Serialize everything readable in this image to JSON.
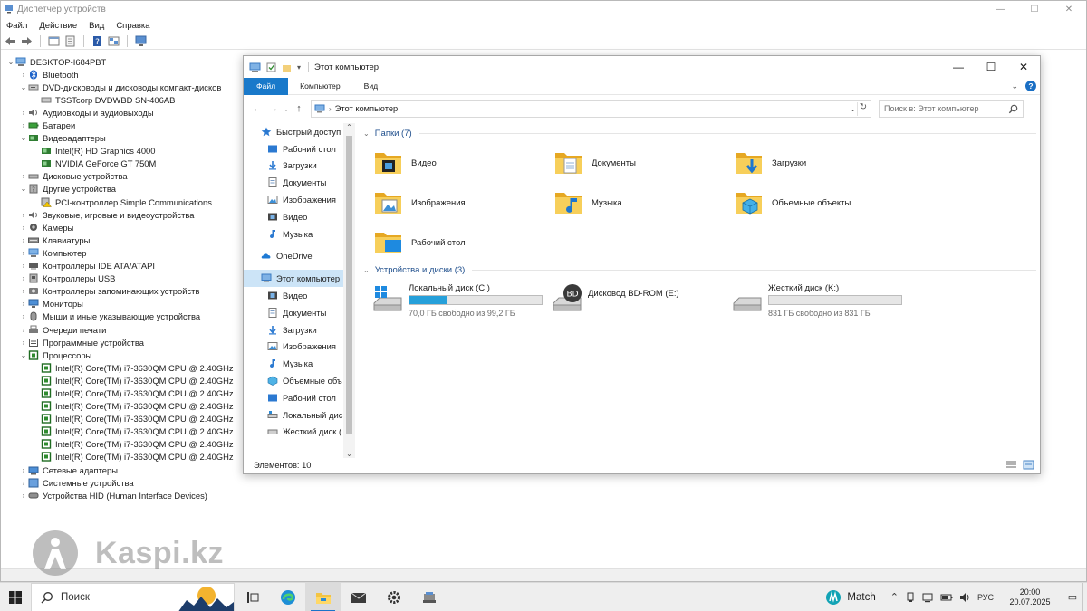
{
  "device_manager": {
    "title": "Диспетчер устройств",
    "menu": [
      "Файл",
      "Действие",
      "Вид",
      "Справка"
    ],
    "tree": [
      {
        "indent": 0,
        "arrow": "v",
        "icon": "computer-icon",
        "label": "DESKTOP-I684PBT"
      },
      {
        "indent": 1,
        "arrow": ">",
        "icon": "bluetooth-icon",
        "label": "Bluetooth"
      },
      {
        "indent": 1,
        "arrow": "v",
        "icon": "dvd-drive-icon",
        "label": "DVD-дисководы и дисководы компакт-дисков"
      },
      {
        "indent": 2,
        "arrow": "",
        "icon": "dvd-drive-icon",
        "label": "TSSTcorp DVDWBD SN-406AB"
      },
      {
        "indent": 1,
        "arrow": ">",
        "icon": "audio-icon",
        "label": "Аудиовходы и аудиовыходы"
      },
      {
        "indent": 1,
        "arrow": ">",
        "icon": "battery-icon",
        "label": "Батареи"
      },
      {
        "indent": 1,
        "arrow": "v",
        "icon": "display-adapter-icon",
        "label": "Видеоадаптеры"
      },
      {
        "indent": 2,
        "arrow": "",
        "icon": "display-adapter-icon",
        "label": "Intel(R) HD Graphics 4000"
      },
      {
        "indent": 2,
        "arrow": "",
        "icon": "display-adapter-icon",
        "label": "NVIDIA GeForce GT 750M"
      },
      {
        "indent": 1,
        "arrow": ">",
        "icon": "disk-drive-icon",
        "label": "Дисковые устройства"
      },
      {
        "indent": 1,
        "arrow": "v",
        "icon": "other-device-icon",
        "label": "Другие устройства"
      },
      {
        "indent": 2,
        "arrow": "",
        "icon": "warning-device-icon",
        "label": "PCI-контроллер Simple Communications"
      },
      {
        "indent": 1,
        "arrow": ">",
        "icon": "sound-icon",
        "label": "Звуковые, игровые и видеоустройства"
      },
      {
        "indent": 1,
        "arrow": ">",
        "icon": "camera-icon",
        "label": "Камеры"
      },
      {
        "indent": 1,
        "arrow": ">",
        "icon": "keyboard-icon",
        "label": "Клавиатуры"
      },
      {
        "indent": 1,
        "arrow": ">",
        "icon": "computer-icon",
        "label": "Компьютер"
      },
      {
        "indent": 1,
        "arrow": ">",
        "icon": "ide-controller-icon",
        "label": "Контроллеры IDE ATA/ATAPI"
      },
      {
        "indent": 1,
        "arrow": ">",
        "icon": "usb-icon",
        "label": "Контроллеры USB"
      },
      {
        "indent": 1,
        "arrow": ">",
        "icon": "storage-controller-icon",
        "label": "Контроллеры запоминающих устройств"
      },
      {
        "indent": 1,
        "arrow": ">",
        "icon": "monitor-icon",
        "label": "Мониторы"
      },
      {
        "indent": 1,
        "arrow": ">",
        "icon": "mouse-icon",
        "label": "Мыши и иные указывающие устройства"
      },
      {
        "indent": 1,
        "arrow": ">",
        "icon": "printer-icon",
        "label": "Очереди печати"
      },
      {
        "indent": 1,
        "arrow": ">",
        "icon": "software-device-icon",
        "label": "Программные устройства"
      },
      {
        "indent": 1,
        "arrow": "v",
        "icon": "processor-icon",
        "label": "Процессоры"
      },
      {
        "indent": 2,
        "arrow": "",
        "icon": "processor-icon",
        "label": "Intel(R) Core(TM) i7-3630QM CPU @ 2.40GHz"
      },
      {
        "indent": 2,
        "arrow": "",
        "icon": "processor-icon",
        "label": "Intel(R) Core(TM) i7-3630QM CPU @ 2.40GHz"
      },
      {
        "indent": 2,
        "arrow": "",
        "icon": "processor-icon",
        "label": "Intel(R) Core(TM) i7-3630QM CPU @ 2.40GHz"
      },
      {
        "indent": 2,
        "arrow": "",
        "icon": "processor-icon",
        "label": "Intel(R) Core(TM) i7-3630QM CPU @ 2.40GHz"
      },
      {
        "indent": 2,
        "arrow": "",
        "icon": "processor-icon",
        "label": "Intel(R) Core(TM) i7-3630QM CPU @ 2.40GHz"
      },
      {
        "indent": 2,
        "arrow": "",
        "icon": "processor-icon",
        "label": "Intel(R) Core(TM) i7-3630QM CPU @ 2.40GHz"
      },
      {
        "indent": 2,
        "arrow": "",
        "icon": "processor-icon",
        "label": "Intel(R) Core(TM) i7-3630QM CPU @ 2.40GHz"
      },
      {
        "indent": 2,
        "arrow": "",
        "icon": "processor-icon",
        "label": "Intel(R) Core(TM) i7-3630QM CPU @ 2.40GHz"
      },
      {
        "indent": 1,
        "arrow": ">",
        "icon": "network-adapter-icon",
        "label": "Сетевые адаптеры"
      },
      {
        "indent": 1,
        "arrow": ">",
        "icon": "system-device-icon",
        "label": "Системные устройства"
      },
      {
        "indent": 1,
        "arrow": ">",
        "icon": "hid-icon",
        "label": "Устройства HID (Human Interface Devices)"
      }
    ]
  },
  "watermark": {
    "text": "Kaspi.kz"
  },
  "explorer": {
    "title": "Этот компьютер",
    "ribbon_tabs": [
      "Файл",
      "Компьютер",
      "Вид"
    ],
    "help_label": "?",
    "address": "Этот компьютер",
    "search_placeholder": "Поиск в: Этот компьютер",
    "nav": [
      {
        "label": "Быстрый доступ",
        "icon": "star-icon",
        "top": true,
        "pin": false,
        "selected": false
      },
      {
        "label": "Рабочий стол",
        "icon": "desktop-icon",
        "top": false,
        "pin": true,
        "selected": false
      },
      {
        "label": "Загрузки",
        "icon": "downloads-icon",
        "top": false,
        "pin": true,
        "selected": false
      },
      {
        "label": "Документы",
        "icon": "documents-icon",
        "top": false,
        "pin": true,
        "selected": false
      },
      {
        "label": "Изображения",
        "icon": "pictures-icon",
        "top": false,
        "pin": true,
        "selected": false
      },
      {
        "label": "Видео",
        "icon": "videos-icon",
        "top": false,
        "pin": false,
        "selected": false
      },
      {
        "label": "Музыка",
        "icon": "music-icon",
        "top": false,
        "pin": false,
        "selected": false
      },
      {
        "label": "",
        "icon": "",
        "top": true,
        "pin": false,
        "selected": false
      },
      {
        "label": "OneDrive",
        "icon": "onedrive-icon",
        "top": true,
        "pin": false,
        "selected": false
      },
      {
        "label": "",
        "icon": "",
        "top": true,
        "pin": false,
        "selected": false
      },
      {
        "label": "Этот компьютер",
        "icon": "this-pc-icon",
        "top": true,
        "pin": false,
        "selected": true
      },
      {
        "label": "Видео",
        "icon": "videos-icon",
        "top": false,
        "pin": false,
        "selected": false
      },
      {
        "label": "Документы",
        "icon": "documents-icon",
        "top": false,
        "pin": false,
        "selected": false
      },
      {
        "label": "Загрузки",
        "icon": "downloads-icon",
        "top": false,
        "pin": false,
        "selected": false
      },
      {
        "label": "Изображения",
        "icon": "pictures-icon",
        "top": false,
        "pin": false,
        "selected": false
      },
      {
        "label": "Музыка",
        "icon": "music-icon",
        "top": false,
        "pin": false,
        "selected": false
      },
      {
        "label": "Объемные объ",
        "icon": "3d-objects-icon",
        "top": false,
        "pin": false,
        "selected": false
      },
      {
        "label": "Рабочий стол",
        "icon": "desktop-icon",
        "top": false,
        "pin": false,
        "selected": false
      },
      {
        "label": "Локальный дис",
        "icon": "local-disk-icon",
        "top": false,
        "pin": false,
        "selected": false
      },
      {
        "label": "Жесткий диск (",
        "icon": "hard-disk-icon",
        "top": false,
        "pin": false,
        "selected": false
      }
    ],
    "folders_header": "Папки (7)",
    "folders": [
      {
        "name": "Видео",
        "icon": "videos-folder-icon"
      },
      {
        "name": "Документы",
        "icon": "documents-folder-icon"
      },
      {
        "name": "Загрузки",
        "icon": "downloads-folder-icon"
      },
      {
        "name": "Изображения",
        "icon": "pictures-folder-icon"
      },
      {
        "name": "Музыка",
        "icon": "music-folder-icon"
      },
      {
        "name": "Объемные объекты",
        "icon": "3d-objects-folder-icon"
      },
      {
        "name": "Рабочий стол",
        "icon": "desktop-folder-icon"
      }
    ],
    "drives_header": "Устройства и диски (3)",
    "drives": [
      {
        "name": "Локальный диск (C:)",
        "free": "70,0 ГБ свободно из 99,2 ГБ",
        "used_fraction": 0.29,
        "icon": "windows-drive-icon",
        "has_bar": true
      },
      {
        "name": "Дисковод BD-ROM (E:)",
        "free": "",
        "used_fraction": 0,
        "icon": "bd-rom-icon",
        "has_bar": false
      },
      {
        "name": "Жесткий диск  (K:)",
        "free": "831 ГБ свободно из 831 ГБ",
        "used_fraction": 0.0,
        "icon": "hard-drive-icon",
        "has_bar": true
      }
    ],
    "status": "Элементов: 10"
  },
  "taskbar": {
    "search_placeholder": "Поиск",
    "weather_label": "Match",
    "language": "РУС",
    "time": "20:00",
    "date": "20.07.2025",
    "apps": [
      "task-view-icon",
      "edge-icon",
      "file-explorer-icon",
      "mail-icon",
      "settings-icon",
      "device-manager-icon"
    ],
    "active_app": "file-explorer-icon"
  },
  "colors": {
    "accent": "#1979ca",
    "selection": "#cce4f7",
    "drive_fill": "#26a0da",
    "folder": "#f3c443",
    "group_header": "#1e4e8c"
  }
}
